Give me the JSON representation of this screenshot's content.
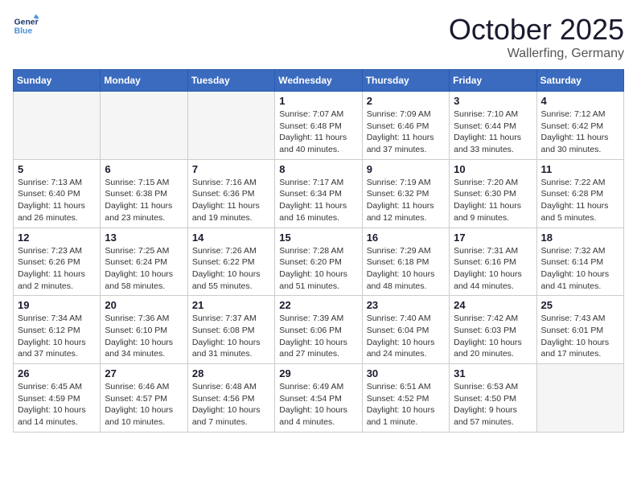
{
  "header": {
    "logo_line1": "General",
    "logo_line2": "Blue",
    "month": "October 2025",
    "location": "Wallerfing, Germany"
  },
  "weekdays": [
    "Sunday",
    "Monday",
    "Tuesday",
    "Wednesday",
    "Thursday",
    "Friday",
    "Saturday"
  ],
  "weeks": [
    [
      {
        "day": "",
        "info": ""
      },
      {
        "day": "",
        "info": ""
      },
      {
        "day": "",
        "info": ""
      },
      {
        "day": "1",
        "info": "Sunrise: 7:07 AM\nSunset: 6:48 PM\nDaylight: 11 hours\nand 40 minutes."
      },
      {
        "day": "2",
        "info": "Sunrise: 7:09 AM\nSunset: 6:46 PM\nDaylight: 11 hours\nand 37 minutes."
      },
      {
        "day": "3",
        "info": "Sunrise: 7:10 AM\nSunset: 6:44 PM\nDaylight: 11 hours\nand 33 minutes."
      },
      {
        "day": "4",
        "info": "Sunrise: 7:12 AM\nSunset: 6:42 PM\nDaylight: 11 hours\nand 30 minutes."
      }
    ],
    [
      {
        "day": "5",
        "info": "Sunrise: 7:13 AM\nSunset: 6:40 PM\nDaylight: 11 hours\nand 26 minutes."
      },
      {
        "day": "6",
        "info": "Sunrise: 7:15 AM\nSunset: 6:38 PM\nDaylight: 11 hours\nand 23 minutes."
      },
      {
        "day": "7",
        "info": "Sunrise: 7:16 AM\nSunset: 6:36 PM\nDaylight: 11 hours\nand 19 minutes."
      },
      {
        "day": "8",
        "info": "Sunrise: 7:17 AM\nSunset: 6:34 PM\nDaylight: 11 hours\nand 16 minutes."
      },
      {
        "day": "9",
        "info": "Sunrise: 7:19 AM\nSunset: 6:32 PM\nDaylight: 11 hours\nand 12 minutes."
      },
      {
        "day": "10",
        "info": "Sunrise: 7:20 AM\nSunset: 6:30 PM\nDaylight: 11 hours\nand 9 minutes."
      },
      {
        "day": "11",
        "info": "Sunrise: 7:22 AM\nSunset: 6:28 PM\nDaylight: 11 hours\nand 5 minutes."
      }
    ],
    [
      {
        "day": "12",
        "info": "Sunrise: 7:23 AM\nSunset: 6:26 PM\nDaylight: 11 hours\nand 2 minutes."
      },
      {
        "day": "13",
        "info": "Sunrise: 7:25 AM\nSunset: 6:24 PM\nDaylight: 10 hours\nand 58 minutes."
      },
      {
        "day": "14",
        "info": "Sunrise: 7:26 AM\nSunset: 6:22 PM\nDaylight: 10 hours\nand 55 minutes."
      },
      {
        "day": "15",
        "info": "Sunrise: 7:28 AM\nSunset: 6:20 PM\nDaylight: 10 hours\nand 51 minutes."
      },
      {
        "day": "16",
        "info": "Sunrise: 7:29 AM\nSunset: 6:18 PM\nDaylight: 10 hours\nand 48 minutes."
      },
      {
        "day": "17",
        "info": "Sunrise: 7:31 AM\nSunset: 6:16 PM\nDaylight: 10 hours\nand 44 minutes."
      },
      {
        "day": "18",
        "info": "Sunrise: 7:32 AM\nSunset: 6:14 PM\nDaylight: 10 hours\nand 41 minutes."
      }
    ],
    [
      {
        "day": "19",
        "info": "Sunrise: 7:34 AM\nSunset: 6:12 PM\nDaylight: 10 hours\nand 37 minutes."
      },
      {
        "day": "20",
        "info": "Sunrise: 7:36 AM\nSunset: 6:10 PM\nDaylight: 10 hours\nand 34 minutes."
      },
      {
        "day": "21",
        "info": "Sunrise: 7:37 AM\nSunset: 6:08 PM\nDaylight: 10 hours\nand 31 minutes."
      },
      {
        "day": "22",
        "info": "Sunrise: 7:39 AM\nSunset: 6:06 PM\nDaylight: 10 hours\nand 27 minutes."
      },
      {
        "day": "23",
        "info": "Sunrise: 7:40 AM\nSunset: 6:04 PM\nDaylight: 10 hours\nand 24 minutes."
      },
      {
        "day": "24",
        "info": "Sunrise: 7:42 AM\nSunset: 6:03 PM\nDaylight: 10 hours\nand 20 minutes."
      },
      {
        "day": "25",
        "info": "Sunrise: 7:43 AM\nSunset: 6:01 PM\nDaylight: 10 hours\nand 17 minutes."
      }
    ],
    [
      {
        "day": "26",
        "info": "Sunrise: 6:45 AM\nSunset: 4:59 PM\nDaylight: 10 hours\nand 14 minutes."
      },
      {
        "day": "27",
        "info": "Sunrise: 6:46 AM\nSunset: 4:57 PM\nDaylight: 10 hours\nand 10 minutes."
      },
      {
        "day": "28",
        "info": "Sunrise: 6:48 AM\nSunset: 4:56 PM\nDaylight: 10 hours\nand 7 minutes."
      },
      {
        "day": "29",
        "info": "Sunrise: 6:49 AM\nSunset: 4:54 PM\nDaylight: 10 hours\nand 4 minutes."
      },
      {
        "day": "30",
        "info": "Sunrise: 6:51 AM\nSunset: 4:52 PM\nDaylight: 10 hours\nand 1 minute."
      },
      {
        "day": "31",
        "info": "Sunrise: 6:53 AM\nSunset: 4:50 PM\nDaylight: 9 hours\nand 57 minutes."
      },
      {
        "day": "",
        "info": ""
      }
    ]
  ]
}
